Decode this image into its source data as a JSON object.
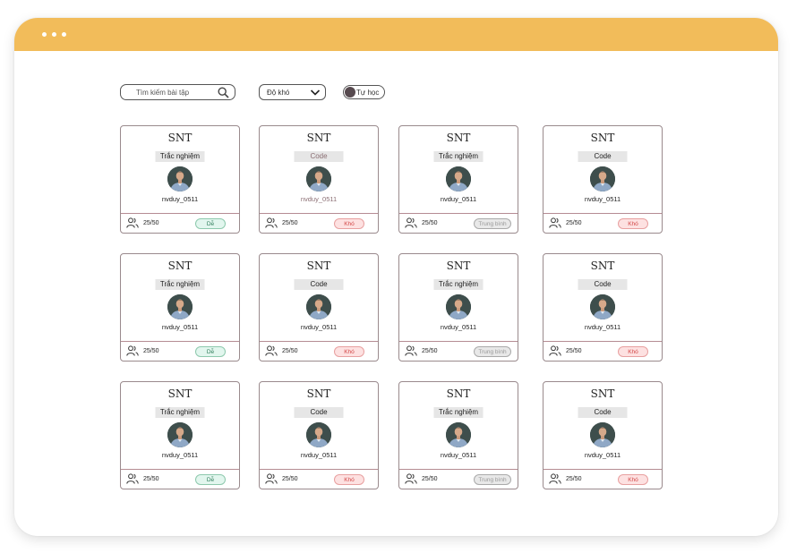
{
  "window": {
    "titlebar_color": "#f2bc5a"
  },
  "filters": {
    "search_placeholder": "Tìm kiếm bài tập",
    "difficulty_label": "Độ khó",
    "self_study_label": "Tự học"
  },
  "cards": [
    {
      "title": "SNT",
      "type": "Trắc nghiệm",
      "user": "nvduy_0511",
      "count": "25/50",
      "difficulty": "Dễ",
      "level": "easy"
    },
    {
      "title": "SNT",
      "type": "Code",
      "user": "nvduy_0511",
      "count": "25/50",
      "difficulty": "Khó",
      "level": "hard"
    },
    {
      "title": "SNT",
      "type": "Trắc nghiệm",
      "user": "nvduy_0511",
      "count": "25/50",
      "difficulty": "Trung bình",
      "level": "medium"
    },
    {
      "title": "SNT",
      "type": "Code",
      "user": "nvduy_0511",
      "count": "25/50",
      "difficulty": "Khó",
      "level": "hard"
    },
    {
      "title": "SNT",
      "type": "Trắc nghiệm",
      "user": "nvduy_0511",
      "count": "25/50",
      "difficulty": "Dễ",
      "level": "easy"
    },
    {
      "title": "SNT",
      "type": "Code",
      "user": "nvduy_0511",
      "count": "25/50",
      "difficulty": "Khó",
      "level": "hard"
    },
    {
      "title": "SNT",
      "type": "Trắc nghiệm",
      "user": "nvduy_0511",
      "count": "25/50",
      "difficulty": "Trung bình",
      "level": "medium"
    },
    {
      "title": "SNT",
      "type": "Code",
      "user": "nvduy_0511",
      "count": "25/50",
      "difficulty": "Khó",
      "level": "hard"
    },
    {
      "title": "SNT",
      "type": "Trắc nghiệm",
      "user": "nvduy_0511",
      "count": "25/50",
      "difficulty": "Dễ",
      "level": "easy"
    },
    {
      "title": "SNT",
      "type": "Code",
      "user": "nvduy_0511",
      "count": "25/50",
      "difficulty": "Khó",
      "level": "hard"
    },
    {
      "title": "SNT",
      "type": "Trắc nghiệm",
      "user": "nvduy_0511",
      "count": "25/50",
      "difficulty": "Trung bình",
      "level": "medium"
    },
    {
      "title": "SNT",
      "type": "Code",
      "user": "nvduy_0511",
      "count": "25/50",
      "difficulty": "Khó",
      "level": "hard"
    }
  ]
}
